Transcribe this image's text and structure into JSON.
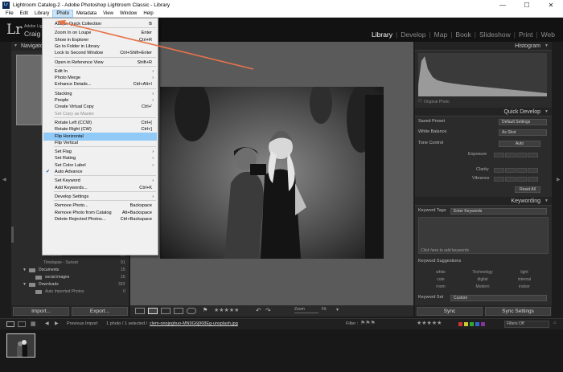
{
  "window": {
    "title": "Lightroom Catalog-2 - Adobe Photoshop Lightroom Classic - Library",
    "app_icon": "Lr",
    "controls": [
      "—",
      "☐",
      "✕"
    ]
  },
  "menubar": [
    "File",
    "Edit",
    "Library",
    "Photo",
    "Metadata",
    "View",
    "Window",
    "Help"
  ],
  "identity": {
    "logo": "Lr",
    "subtitle": "Adobe Lightroom",
    "user": "Craig H"
  },
  "modules": [
    "Library",
    "Develop",
    "Map",
    "Book",
    "Slideshow",
    "Print",
    "Web"
  ],
  "modules_active": "Library",
  "left_panel": {
    "navigator": "Navigato",
    "folders": [
      {
        "name": "lens parts",
        "count": "20"
      },
      {
        "name": "Timelapse - Sunset",
        "count": "91"
      },
      {
        "name": "Documents",
        "count": "15"
      },
      {
        "name": "social images",
        "count": "15"
      },
      {
        "name": "Downloads",
        "count": "323"
      },
      {
        "name": "Auto Imported Photos",
        "count": "0"
      }
    ]
  },
  "photo_menu": {
    "items": [
      {
        "label": "Add to Quick Collection",
        "shortcut": "B"
      },
      {
        "sep": true
      },
      {
        "label": "Zoom In on Loupe",
        "shortcut": "Enter"
      },
      {
        "label": "Show in Explorer",
        "shortcut": "Ctrl+R"
      },
      {
        "label": "Go to Folder in Library",
        "shortcut": ""
      },
      {
        "label": "Lock to Second Window",
        "shortcut": "Ctrl+Shift+Enter"
      },
      {
        "sep": true
      },
      {
        "label": "Open in Reference View",
        "shortcut": "Shift+R"
      },
      {
        "sep": true
      },
      {
        "label": "Edit In",
        "sub": true
      },
      {
        "label": "Photo Merge",
        "sub": true
      },
      {
        "label": "Enhance Details...",
        "shortcut": "Ctrl+Alt+I"
      },
      {
        "sep": true
      },
      {
        "label": "Stacking",
        "sub": true
      },
      {
        "label": "People",
        "sub": true
      },
      {
        "label": "Create Virtual Copy",
        "shortcut": "Ctrl+'"
      },
      {
        "label": "Set Copy as Master",
        "disabled": true
      },
      {
        "sep": true
      },
      {
        "label": "Rotate Left (CCW)",
        "shortcut": "Ctrl+["
      },
      {
        "label": "Rotate Right (CW)",
        "shortcut": "Ctrl+]"
      },
      {
        "label": "Flip Horizontal",
        "highlighted": true
      },
      {
        "label": "Flip Vertical"
      },
      {
        "sep": true
      },
      {
        "label": "Set Flag",
        "sub": true
      },
      {
        "label": "Set Rating",
        "sub": true
      },
      {
        "label": "Set Color Label",
        "sub": true
      },
      {
        "label": "Auto Advance",
        "checked": true
      },
      {
        "sep": true
      },
      {
        "label": "Set Keyword",
        "sub": true
      },
      {
        "label": "Add Keywords...",
        "shortcut": "Ctrl+K"
      },
      {
        "sep": true
      },
      {
        "label": "Develop Settings",
        "sub": true
      },
      {
        "sep": true
      },
      {
        "label": "Remove Photo...",
        "shortcut": "Backspace"
      },
      {
        "label": "Remove Photo from Catalog",
        "shortcut": "Alt+Backspace"
      },
      {
        "label": "Delete Rejected Photos...",
        "shortcut": "Ctrl+Backspace"
      }
    ]
  },
  "right_panel": {
    "histogram_title": "Histogram",
    "original_photo": "Original Photo",
    "quick_develop_title": "Quick Develop",
    "saved_preset_label": "Saved Preset",
    "saved_preset_value": "Default Settings",
    "white_balance_label": "White Balance",
    "white_balance_value": "As Shot",
    "tone_control_label": "Tone Control",
    "auto_label": "Auto",
    "exposure_label": "Exposure",
    "clarity_label": "Clarity",
    "vibrance_label": "Vibrance",
    "reset_all": "Reset All",
    "keywording_title": "Keywording",
    "keyword_tags_label": "Keyword Tags",
    "keyword_tags_value": "Enter Keywords",
    "click_to_add": "Click here to add keywords",
    "keyword_suggestions": "Keyword Suggestions",
    "suggestions": [
      "white",
      "Technology",
      "light",
      "cute",
      "digital",
      "internal",
      "room",
      "Modern",
      "indoor"
    ],
    "keyword_set_label": "Keyword Set",
    "keyword_set_value": "Custom"
  },
  "bottom": {
    "import_label": "Import...",
    "export_label": "Export...",
    "zoom_label": "Zoom",
    "zoom_value": "Fit",
    "sync_label": "Sync",
    "sync_settings_label": "Sync Settings",
    "prev_import": "Previous Import",
    "selection_info": "1 photo / 1 selected /",
    "filename": "clem-onojeghuo-MN9G6j968Eg-unsplash.jpg",
    "filter_label": "Filter :",
    "filters_off": "Filters Off"
  },
  "colors": {
    "menu_highlight": "#91c9f7",
    "accent_arrow": "#e8734a"
  }
}
